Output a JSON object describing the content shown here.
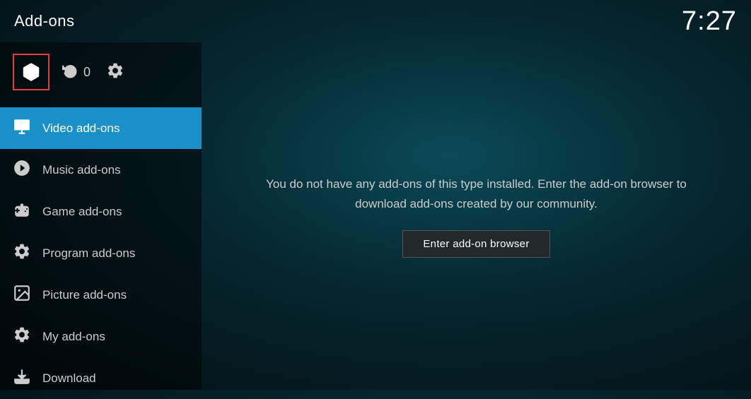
{
  "header": {
    "title": "Add-ons",
    "clock": "7:27"
  },
  "sidebar": {
    "icons": {
      "refresh_count": "0"
    },
    "nav_items": [
      {
        "id": "video-addons",
        "label": "Video add-ons",
        "active": true
      },
      {
        "id": "music-addons",
        "label": "Music add-ons",
        "active": false
      },
      {
        "id": "game-addons",
        "label": "Game add-ons",
        "active": false
      },
      {
        "id": "program-addons",
        "label": "Program add-ons",
        "active": false
      },
      {
        "id": "picture-addons",
        "label": "Picture add-ons",
        "active": false
      },
      {
        "id": "my-addons",
        "label": "My add-ons",
        "active": false
      },
      {
        "id": "download",
        "label": "Download",
        "active": false
      }
    ]
  },
  "main": {
    "empty_message": "You do not have any add-ons of this type installed. Enter the add-on browser to download add-ons created by our community.",
    "browser_button": "Enter add-on browser"
  }
}
